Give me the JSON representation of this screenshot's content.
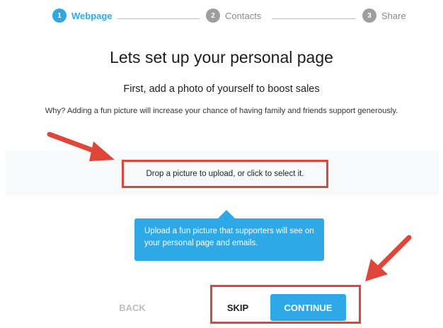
{
  "stepper": {
    "steps": [
      {
        "number": "1",
        "label": "Webpage",
        "state": "active"
      },
      {
        "number": "2",
        "label": "Contacts",
        "state": "inactive"
      },
      {
        "number": "3",
        "label": "Share",
        "state": "inactive"
      }
    ]
  },
  "header": {
    "title": "Lets set up your personal page",
    "subtitle": "First, add a photo of yourself to boost sales",
    "why_text": "Why? Adding a fun picture will increase your chance of having family and friends support generously."
  },
  "upload": {
    "prompt": "Drop a picture to upload, or click to select it."
  },
  "tooltip": {
    "text": "Upload a fun picture that supporters will see on your personal page and emails."
  },
  "nav": {
    "back_label": "BACK",
    "skip_label": "SKIP",
    "continue_label": "CONTINUE"
  },
  "colors": {
    "accent": "#2ea8e6",
    "annotation": "#e0453a",
    "inactive": "#9e9e9e"
  }
}
